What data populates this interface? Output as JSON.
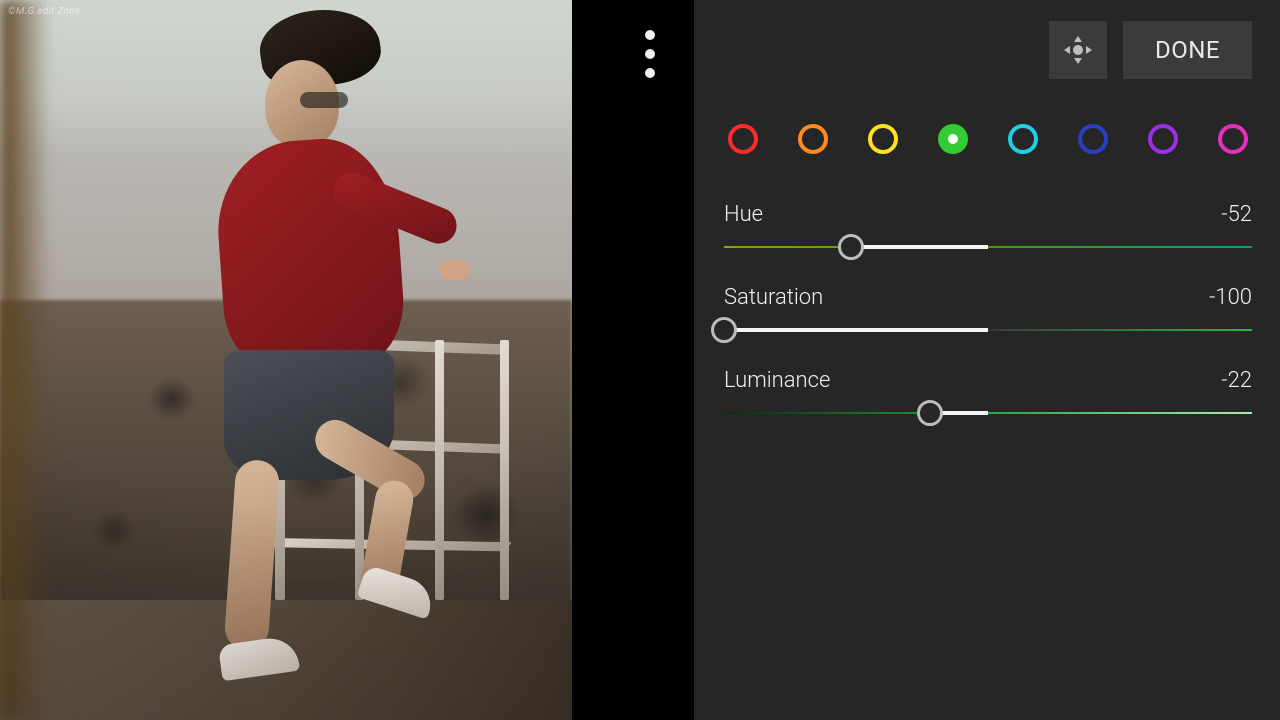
{
  "watermark": "©M.G.edit Zone",
  "toolbar": {
    "done_label": "DONE"
  },
  "color_mix": {
    "channels": [
      {
        "name": "red",
        "color": "#ff2a2a",
        "selected": false
      },
      {
        "name": "orange",
        "color": "#ff8a1f",
        "selected": false
      },
      {
        "name": "yellow",
        "color": "#ffe11f",
        "selected": false
      },
      {
        "name": "green",
        "color": "#33cc33",
        "selected": true
      },
      {
        "name": "aqua",
        "color": "#1fd0e6",
        "selected": false
      },
      {
        "name": "blue",
        "color": "#2a3fbf",
        "selected": false
      },
      {
        "name": "purple",
        "color": "#9a2fe6",
        "selected": false
      },
      {
        "name": "magenta",
        "color": "#e62fbf",
        "selected": false
      }
    ],
    "sliders": {
      "hue": {
        "label": "Hue",
        "value": -52
      },
      "saturation": {
        "label": "Saturation",
        "value": -100
      },
      "luminance": {
        "label": "Luminance",
        "value": -22
      }
    }
  }
}
